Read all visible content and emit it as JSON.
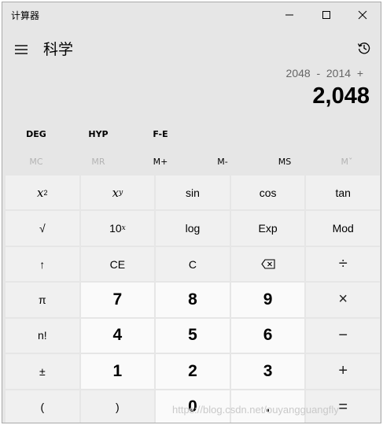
{
  "window": {
    "title": "计算器",
    "controls": {
      "minimize": "minimize-icon",
      "maximize": "maximize-icon",
      "close": "close-icon"
    }
  },
  "header": {
    "menu_icon": "hamburger-menu-icon",
    "mode_title": "科学",
    "history_icon": "history-icon"
  },
  "display": {
    "expression": "2048  -  2014  +",
    "result": "2,048"
  },
  "mode_buttons": [
    "DEG",
    "HYP",
    "F-E"
  ],
  "memory_buttons": [
    {
      "label": "MC",
      "enabled": false
    },
    {
      "label": "MR",
      "enabled": false
    },
    {
      "label": "M+",
      "enabled": true
    },
    {
      "label": "M-",
      "enabled": true
    },
    {
      "label": "MS",
      "enabled": true
    },
    {
      "label": "Mˇ",
      "enabled": false
    }
  ],
  "keys": {
    "x_squared": {
      "base": "x",
      "sup": "2"
    },
    "x_pow_y": {
      "base": "x",
      "sup": "y"
    },
    "sin": "sin",
    "cos": "cos",
    "tan": "tan",
    "sqrt": "√",
    "ten_pow_x": {
      "base": "10",
      "sup": "x"
    },
    "log": "log",
    "exp": "Exp",
    "mod": "Mod",
    "shift": "↑",
    "ce": "CE",
    "c": "C",
    "backspace_icon": "backspace-icon",
    "divide": "÷",
    "pi": "π",
    "seven": "7",
    "eight": "8",
    "nine": "9",
    "multiply": "×",
    "factorial": "n!",
    "four": "4",
    "five": "5",
    "six": "6",
    "minus": "−",
    "negate": "±",
    "one": "1",
    "two": "2",
    "three": "3",
    "plus": "+",
    "lparen": "(",
    "rparen": ")",
    "zero": "0",
    "decimal": ".",
    "equals": "="
  },
  "watermark": "https://blog.csdn.net/ouyangguangfly"
}
